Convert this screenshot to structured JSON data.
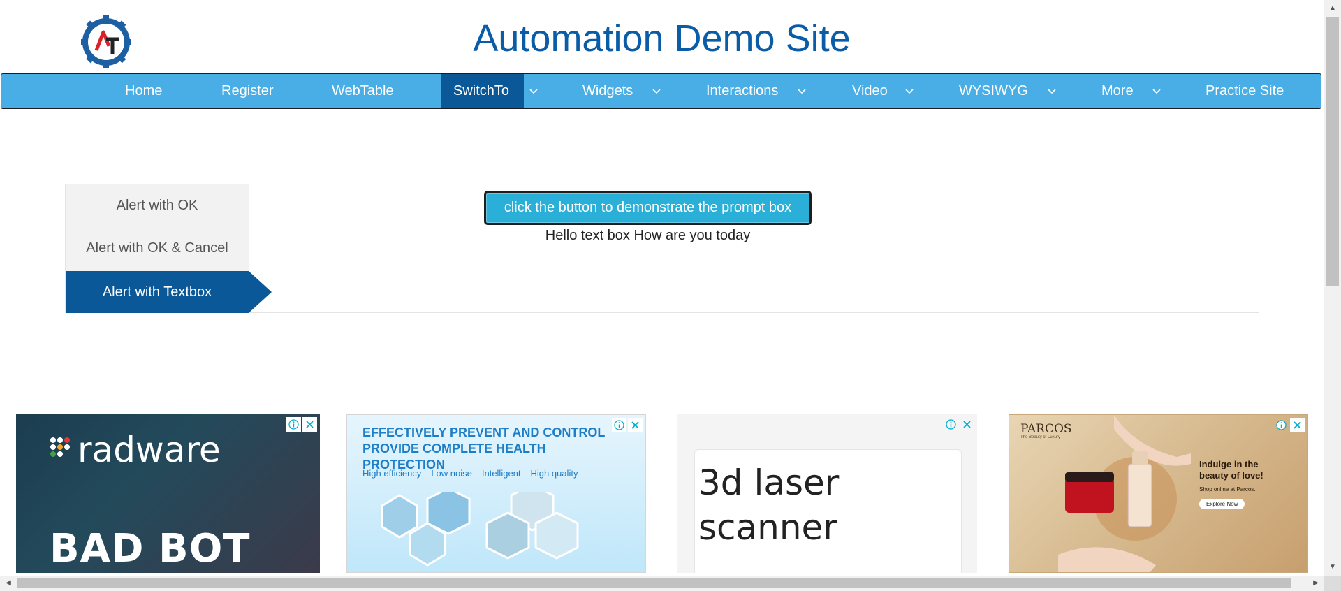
{
  "header": {
    "title": "Automation Demo Site",
    "logo_text": "AT"
  },
  "nav": {
    "items": [
      {
        "label": "Home",
        "has_dropdown": false
      },
      {
        "label": "Register",
        "has_dropdown": false
      },
      {
        "label": "WebTable",
        "has_dropdown": false
      },
      {
        "label": "SwitchTo",
        "has_dropdown": true,
        "active": true
      },
      {
        "label": "Widgets",
        "has_dropdown": true
      },
      {
        "label": "Interactions",
        "has_dropdown": true
      },
      {
        "label": "Video",
        "has_dropdown": true
      },
      {
        "label": "WYSIWYG",
        "has_dropdown": true
      },
      {
        "label": "More",
        "has_dropdown": true
      },
      {
        "label": "Practice Site",
        "has_dropdown": false
      }
    ]
  },
  "alerts": {
    "tabs": [
      {
        "label": "Alert with OK"
      },
      {
        "label": "Alert with OK & Cancel"
      },
      {
        "label": "Alert with Textbox",
        "active": true
      }
    ],
    "button_label": "click the button to demonstrate the prompt box",
    "result_text": "Hello text box How are you today"
  },
  "ads": [
    {
      "brand": "radware",
      "headline": "BAD BOT"
    },
    {
      "headline": "EFFECTIVELY PREVENT AND CONTROL PROVIDE COMPLETE HEALTH PROTECTION",
      "features": [
        "High efficiency",
        "Low noise",
        "Intelligent",
        "High quality"
      ]
    },
    {
      "headline": "3d laser scanner"
    },
    {
      "brand": "PARCOS",
      "tagline": "The Beauty of Luxury",
      "copy": "Indulge in the beauty of love!",
      "sub": "Shop online at Parcos.",
      "cta": "Explore Now"
    }
  ],
  "colors": {
    "nav_bg": "#4aaee6",
    "nav_active": "#0a5897",
    "title": "#0a5ca6",
    "button": "#2ab0d8"
  }
}
